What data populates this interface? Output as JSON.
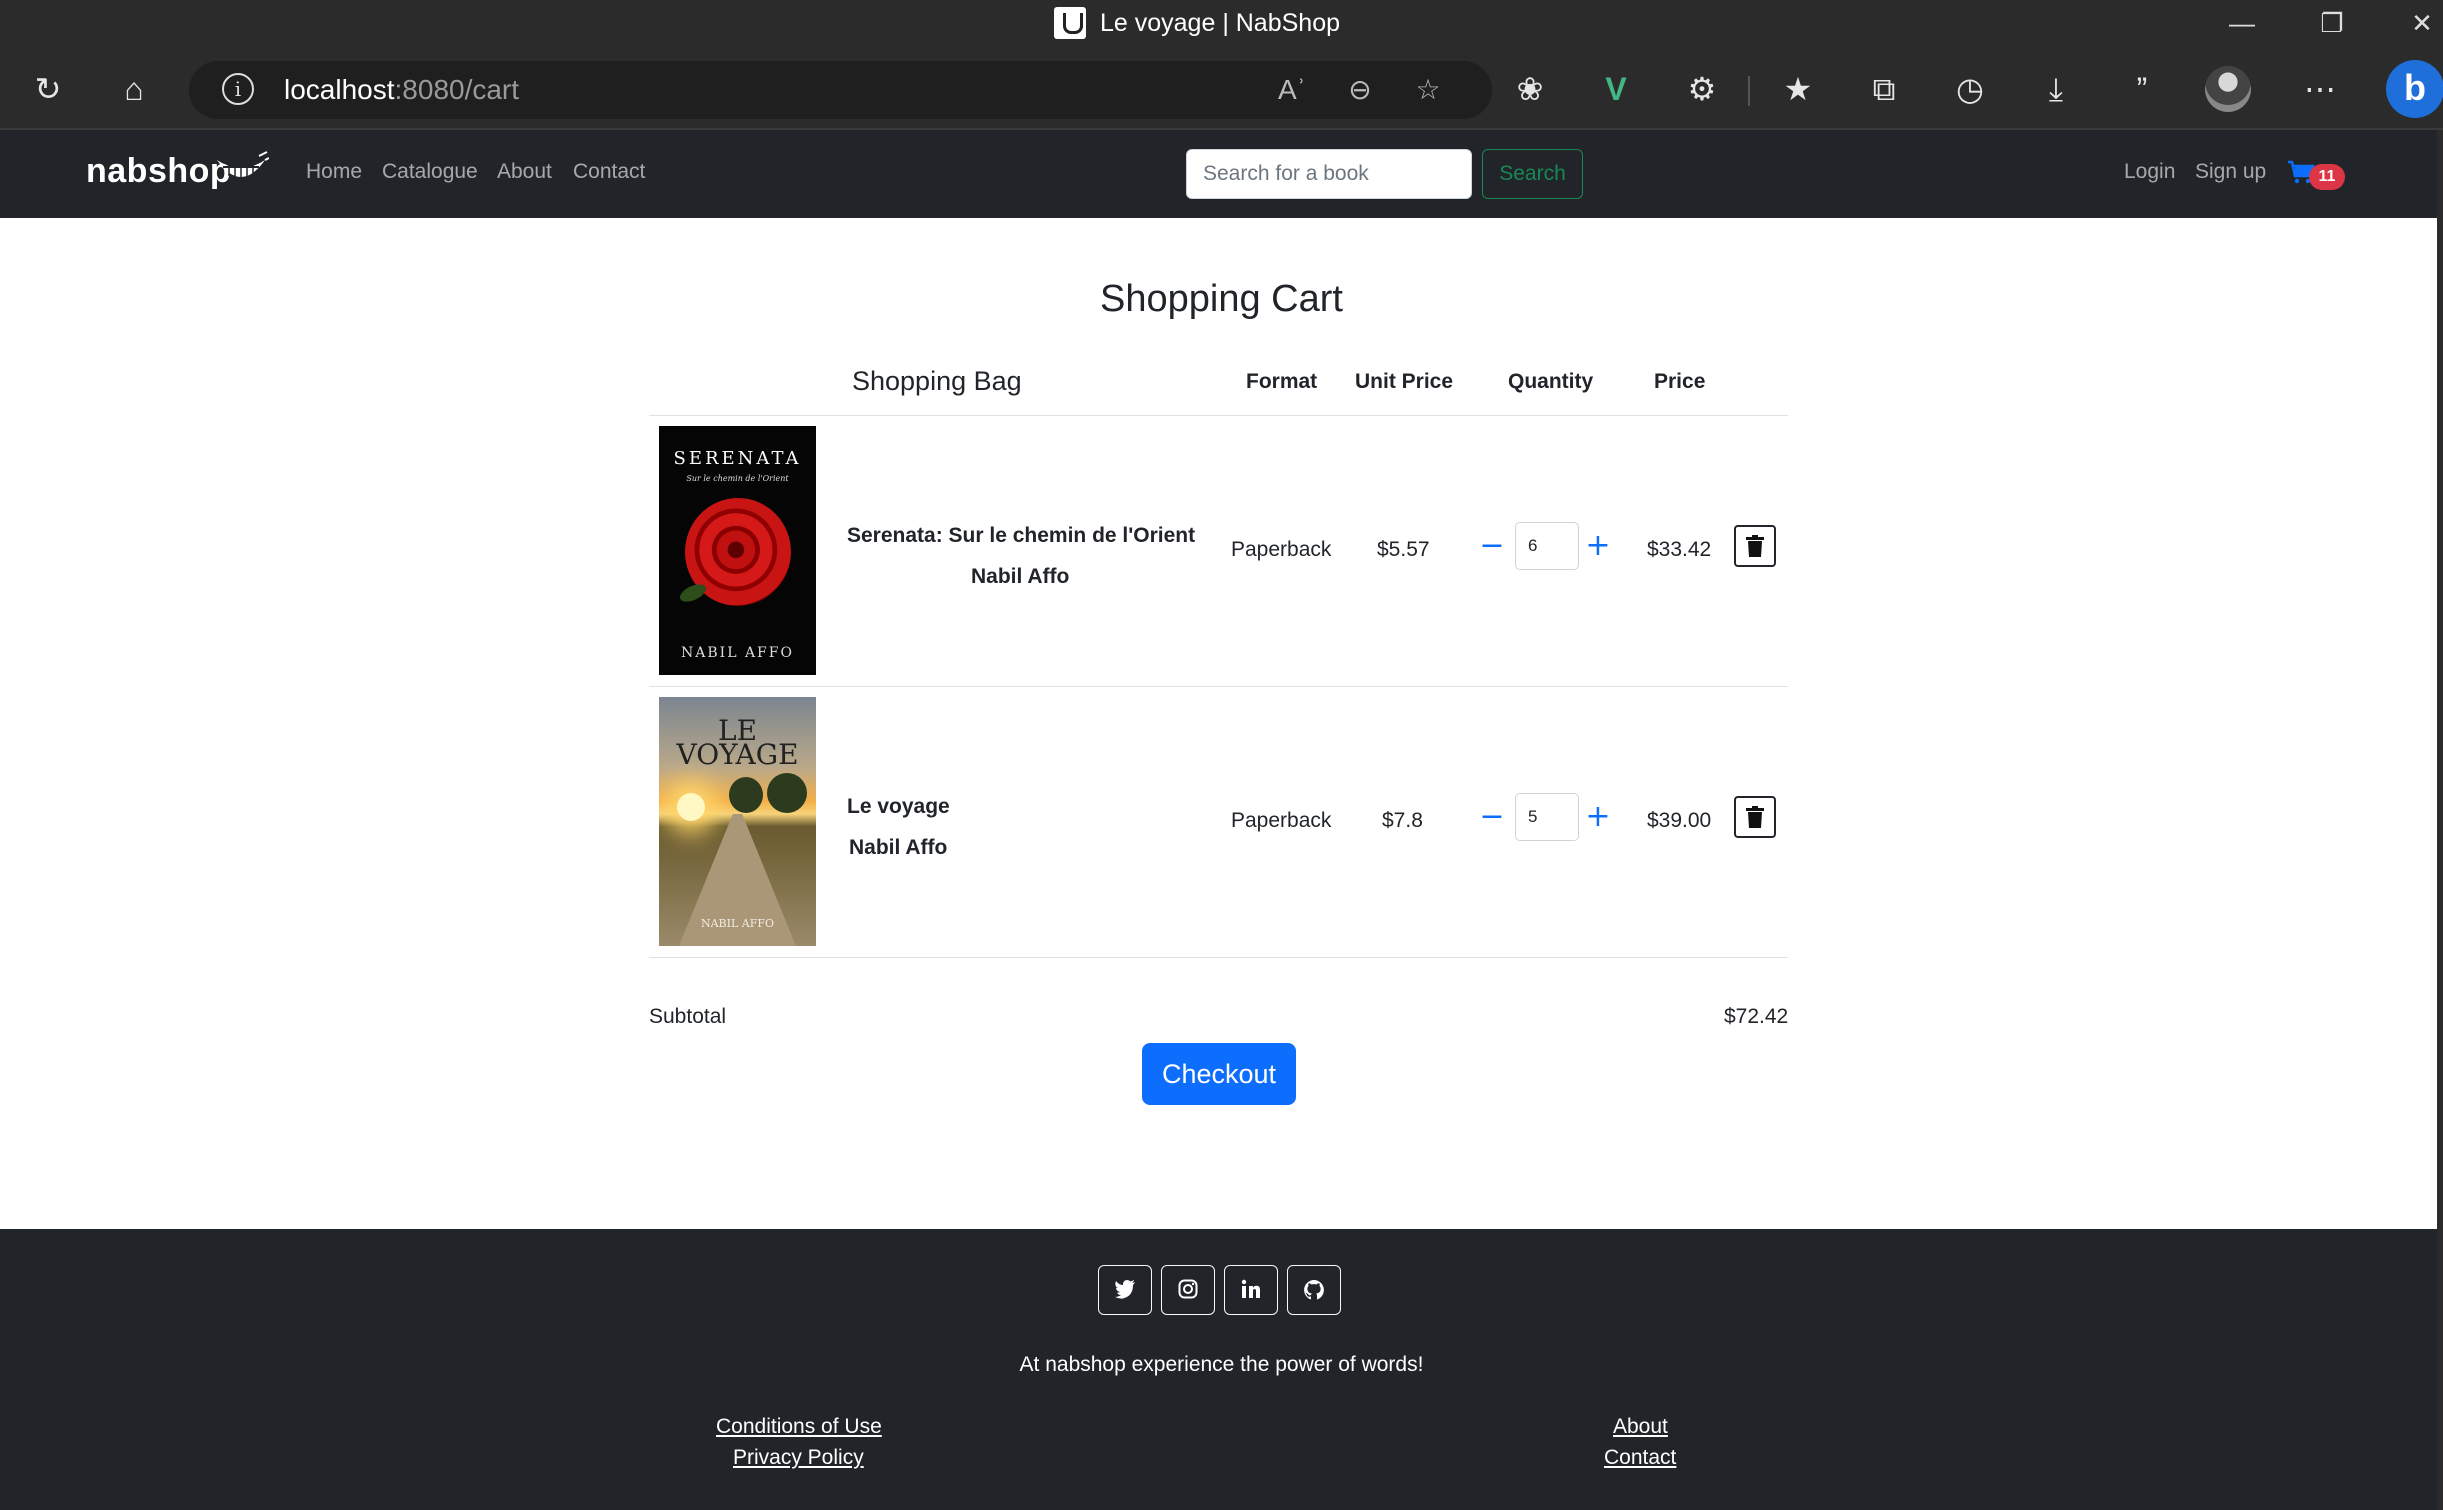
{
  "browser": {
    "tab_title": "Le voyage | NabShop",
    "url_host": "localhost",
    "url_path": ":8080/cart"
  },
  "navbar": {
    "brand": "nabshop",
    "links": [
      "Home",
      "Catalogue",
      "About",
      "Contact"
    ],
    "search_placeholder": "Search for a book",
    "search_button": "Search",
    "login": "Login",
    "signup": "Sign up",
    "cart_count": "11"
  },
  "cart": {
    "title": "Shopping Cart",
    "headers": {
      "bag": "Shopping Bag",
      "format": "Format",
      "unit_price": "Unit Price",
      "quantity": "Quantity",
      "price": "Price"
    },
    "items": [
      {
        "title": "Serenata: Sur le chemin de l'Orient",
        "author": "Nabil Affo",
        "format": "Paperback",
        "unit_price": "$5.57",
        "quantity": "6",
        "price": "$33.42",
        "cover": {
          "title": "SERENATA",
          "subtitle": "Sur le chemin de l'Orient",
          "author": "NABIL AFFO"
        }
      },
      {
        "title": "Le voyage",
        "author": "Nabil Affo",
        "format": "Paperback",
        "unit_price": "$7.8",
        "quantity": "5",
        "price": "$39.00",
        "cover": {
          "title_line1": "LE",
          "title_line2": "VOYAGE",
          "author": "NABIL AFFO"
        }
      }
    ],
    "subtotal_label": "Subtotal",
    "subtotal_value": "$72.42",
    "checkout": "Checkout"
  },
  "footer": {
    "social": [
      "twitter-icon",
      "instagram-icon",
      "linkedin-icon",
      "github-icon"
    ],
    "tagline": "At nabshop experience the power of words!",
    "links_left": [
      "Conditions of Use",
      "Privacy Policy"
    ],
    "links_right": [
      "About",
      "Contact"
    ]
  },
  "colors": {
    "navbar_bg": "#212529",
    "primary": "#0d6efd",
    "success": "#198754",
    "danger": "#dc3545"
  }
}
